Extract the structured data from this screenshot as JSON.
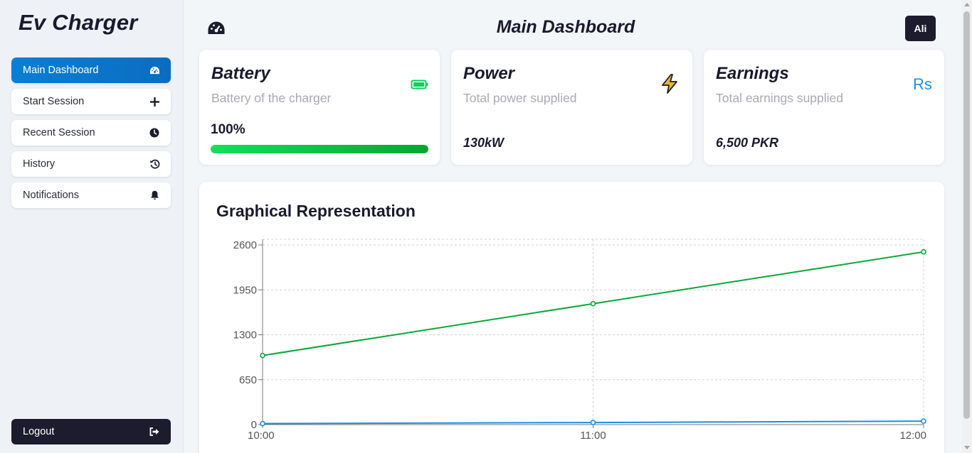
{
  "app": {
    "brand": "Ev Charger"
  },
  "header": {
    "title": "Main Dashboard",
    "user_label": "Ali",
    "icon": "gauge-icon"
  },
  "sidebar": {
    "items": [
      {
        "label": "Main Dashboard",
        "icon": "gauge-icon",
        "active": true
      },
      {
        "label": "Start Session",
        "icon": "plus-icon"
      },
      {
        "label": "Recent Session",
        "icon": "clock-icon"
      },
      {
        "label": "History",
        "icon": "history-icon"
      },
      {
        "label": "Notifications",
        "icon": "bell-icon"
      }
    ],
    "logout": {
      "label": "Logout",
      "icon": "logout-icon"
    }
  },
  "cards": {
    "battery": {
      "title": "Battery",
      "subtitle": "Battery of the charger",
      "value": "100%",
      "level": 1.0,
      "icon": "battery-icon"
    },
    "power": {
      "title": "Power",
      "subtitle": "Total power supplied",
      "value": "130kW",
      "icon": "lightning-icon"
    },
    "earnings": {
      "title": "Earnings",
      "subtitle": "Total earnings supplied",
      "value": "6,500 PKR",
      "icon_text": "Rs"
    }
  },
  "colors": {
    "accent": "#0a7fd4",
    "dark": "#1c1c2e",
    "green": "#0aa838",
    "blue": "#1b8fe0"
  },
  "chart": {
    "title": "Graphical Representation"
  },
  "chart_data": {
    "type": "line",
    "x": [
      "10:00",
      "11:00",
      "12:00"
    ],
    "y_ticks": [
      0,
      650,
      1300,
      1950,
      2600
    ],
    "ylim": [
      0,
      2600
    ],
    "grid": true,
    "series": [
      {
        "values": [
          1000,
          1750,
          2500
        ],
        "color": "#0aa838"
      },
      {
        "values": [
          15,
          30,
          50
        ],
        "color": "#1b8fe0"
      }
    ]
  }
}
